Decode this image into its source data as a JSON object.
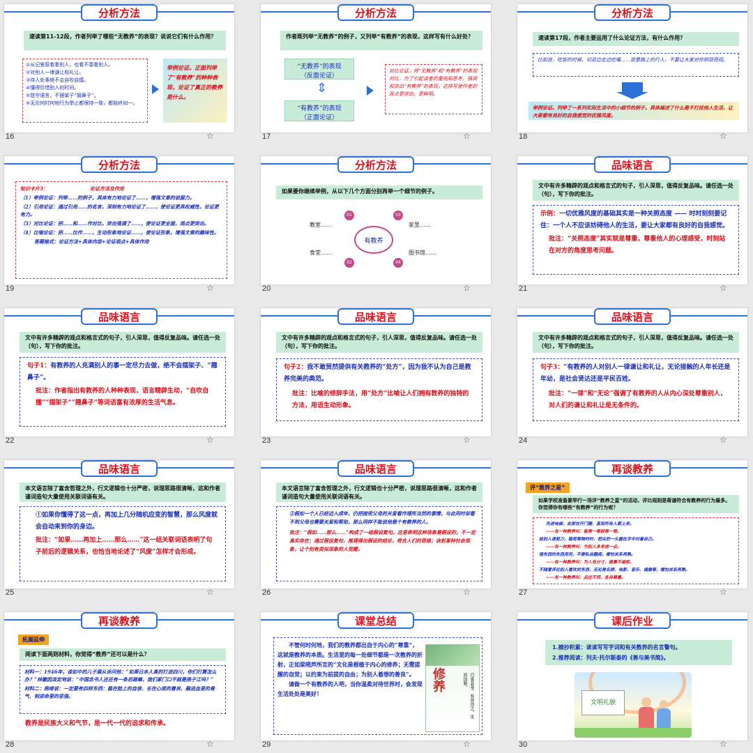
{
  "slides": [
    {
      "num": "16",
      "title": "分析方法",
      "question": "速读第11-12段，作者列举了哪些“无教养”的表现？说说它们有什么作用？",
      "items": [
        "①从记里原看重别人，也看不尊重别人。",
        "②对别人一律谦让和礼让。",
        "③待人处事绝不会自吹自擂。",
        "④懂得珍惜别人的时间。",
        "⑤悠守诺言，不摆架子“翘鼻子”。",
        "⑥无论何时何地行为举止都保持一致，都始终如一。"
      ],
      "answer": "举例论证。正面列举了“有教养”的种种表现，论证了真正的教养是什么。"
    },
    {
      "num": "17",
      "title": "分析方法",
      "question": "作者既列举“无教养”的例子，又列举“有教养”的表现，这样写有什么好处？",
      "box1_line1": "“无教养”的表现",
      "box1_line2": "（反面论证）",
      "box2_line1": "“有教养”的表现",
      "box2_line2": "（正面论证）",
      "answer": "对比论证。将“无教养”和“有教养”的表现对比，为了引起读者的重视和思考，强调和突出“有教养”的表现，这样写使作者的观点更突出、更鲜明。"
    },
    {
      "num": "18",
      "title": "分析方法",
      "question": "速读第17段，作者主要运用了什么论证方法，有什么作用？",
      "text": "比如说，吃饭的时候、切忌边走边吃嘴……致意路上的行人、不要让大家对你侧目而视。",
      "answer": "举例论证。列举了一系列实际生活中的小细节的例子，具体阐述了什么是不打扰他人生活，让大家都有良好的自我感觉的优雅风度。"
    },
    {
      "num": "19",
      "title": "分析方法",
      "card": "知识卡片3：",
      "card_title": "论证方法及作用",
      "l1": "（1）举例论证：列举……的例子，具体有力地论证了……，增强文章的说服力。",
      "l2": "（2）引用论证：通过引用……的名言，深刻有力地论证了……，使论证更具权威性，论证更有力。",
      "l3": "（3）对比论证：把……和……作对比，突出强调了……，使论证更全面，观点更突出。",
      "l4": "（4）比喻论证：把……比作……，生动形象地论证……，使论证形象，增强文章的趣味性。",
      "l5": "答题格式：论证方法+具体内容+论证观点+具体作用"
    },
    {
      "num": "20",
      "title": "分析方法",
      "question": "如果要你继续举例，从以下几个方面分别再举一个细节的例子。",
      "center": "有教养",
      "n1": "01",
      "n2": "02",
      "n3": "03",
      "n4": "04",
      "a": "教室……",
      "b": "家里……",
      "c": "食堂……",
      "d": "图书馆……"
    },
    {
      "num": "21",
      "title": "品味语言",
      "question": "文中有许多精辟的观点和格言式的句子，引人深思，值得反复品味。请任选一处（句），写下你的批注。",
      "example_label": "示例：",
      "example": "一切优雅风度的基础其实是一种关照态度 —— 时时刻刻要记住：一个人不应该妨碍他人的生活，要让大家都有良好的自我感觉。",
      "note_label": "批注：",
      "note": "“关照态度”其实就是尊重，尊重他人的心理感受，时刻站在对方的角度思考问题。"
    },
    {
      "num": "22",
      "title": "品味语言",
      "question": "文中有许多精辟的观点和格言式的句子，引人深思，值得反复品味。请任选一处（句），写下你的批注。",
      "s_label": "句子1：",
      "sentence": "有教养的人充满别人的事一定尽力去做，绝不会摆架子、“翘鼻子”。",
      "note_label": "批注：",
      "note": "作者指出有教养的人种种表现，语言精辟生动，“自吹自擂”“摆架子”“翘鼻子”等词语富有浓厚的生活气息。"
    },
    {
      "num": "23",
      "title": "品味语言",
      "question": "文中有许多精辟的观点和格言式的句子，引人深思，值得反复品味。请任选一处（句），写下你的批注。",
      "s_label": "句子2：",
      "sentence": "我不敢贸然提供有关教养的“处方”，因为我不认为自己是教养完美的典范。",
      "note_label": "批注：",
      "note": "比喻的修辞手法，用“处方”比喻让人们拥有教养的独特的方法，用语生动形象。"
    },
    {
      "num": "24",
      "title": "品味语言",
      "question": "文中有许多精辟的观点和格言式的句子，引人深思，值得反复品味。请任选一处（句），写下你的批注。",
      "s_label": "句子3：",
      "sentence": "“有教养的人对别人一律谦让和礼让，无论接触的人年长还是年幼，是社会贤达还是平民百姓。",
      "note_label": "批注：",
      "note": "“一律”和“无论”强调了有教养的人从内心深处尊重别人，对人们的谦让和礼让是无条件的。"
    },
    {
      "num": "25",
      "title": "品味语言",
      "question": "本文语言除了富含哲理之外，行文逻辑也十分严密，说理思路很清晰，这和作者谨词造句大量使用关联词语有关。",
      "sentence": "①如果你懂得了这一点，再加上几分随机应变的智慧，那么风度就会自动来到你的身边。",
      "note_label": "批注：",
      "note": "“如果……再加上……那么……”这一组关联词语表明了句子前后的逻辑关系，也恰当地论述了“风度”怎样才会形成。"
    },
    {
      "num": "26",
      "title": "品味语言",
      "question": "本文语言除了富含哲理之外，行文逻辑也十分严密，说理思路很清晰，这和作者谨词造句大量使用关联词语有关。",
      "sentence": "②假如一个人已经迈入成年，仍把接受父母的关爱看作理所当然的事情，与此同时却看不到父母也需要关爱和帮助，那么同样不能说他是个有教养的人。",
      "note_label": "批注：",
      "note": "“假如……那么……”构成了一组假设复句。这里表明这种现象是假设的，不一定真实存在；通过假设复句，推理得出假设的结论，将合人们的思维；诀射某种社会现象，让个别有类似现象的人觉醒。"
    },
    {
      "num": "27",
      "title": "再谈教养",
      "tag": "评“教养之星”",
      "question": "如果学校准备要举行一场评“教养之星”的活动，评比规则是蒋谦符合有教养的行为最多。你觉得你有哪些“有教养”的行为呢？",
      "lines": [
        "先进电梯，会按住开门键，直到所有人都上来。",
        "——有一种教养叫：能等一等就等一等。",
        "给别人递剪刀，稳笔等物时时，把尖的一头握在手中对着自己。",
        "——有一种教养叫：为别人多考虑一点。",
        "借东西的东西用完，不要私自翻阅，哪怕关系再熟。",
        "——有一种教养叫：为人有分寸，做事不逾矩。",
        "不随意评论别人喜欢的东西，无论是名牌、电影、音乐、偶像等，哪怕关系再熟。",
        "——有一种教养叫：品位不同，各自尊重。"
      ]
    },
    {
      "num": "28",
      "title": "再谈教养",
      "tag": "拓展延伸",
      "question": "阅读下面两则材料，你觉得“教养”还可以是什么？",
      "m1": "材料一：1946年，谈如中的儿子展从诉问他：“如果日本人真的打进四川，你们打算怎么办？”林徽因淡定地说：“中国念书人还还有一条后路嘛，我们家门口不就是扬子江吗？”",
      "m2": "材料二：杨绛说：一定要有四样东西：稳在脸上的自信、长在心底的善良、融进血里的骨气、刻进命里的坚强。",
      "conclusion": "教养是民族大义和气节，是一代一代的追求和传承。"
    },
    {
      "num": "29",
      "title": "课堂总结",
      "text1": "不管何时何地，我们的教养都出自于内心的“尊重”，这就是教养的本质。生活里的每一处细节都是一次教养的折射，正如梁晓声所言的“文化是根植于内心的修养；无需提醒的自觉；以约束为前提的自由；为别人着想的善良”。",
      "text2": "请做一个有教养的人吧，当你温柔对待世界时，会发现生活处处是美好！",
      "art_title": "修养",
      "art_sub": "日省其身，有则改之，无则加勉。"
    },
    {
      "num": "30",
      "title": "课后作业",
      "h1": "1.摘抄积累：读读写写字词和有关教养的名言警句。",
      "h2": "2.推荐阅读：列夫·托尔斯泰的《善与美书简》。",
      "banner": "文明礼貌"
    }
  ]
}
